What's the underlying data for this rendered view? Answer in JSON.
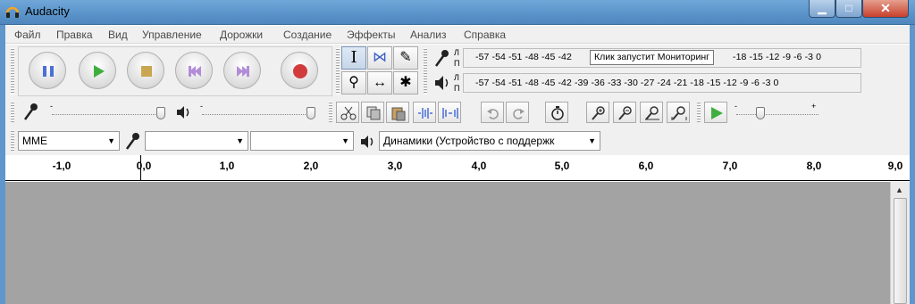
{
  "window": {
    "title": "Audacity",
    "minimize": "▁",
    "maximize": "□",
    "close": "✕"
  },
  "menu": [
    "Файл",
    "Правка",
    "Вид",
    "Управление",
    "Дорожки",
    "Создание",
    "Эффекты",
    "Анализ",
    "Справка"
  ],
  "meters": {
    "record_scale": "-57 -54 -51 -48 -45 -42",
    "record_scale_tail": "-18 -15 -12  -9  -6  -3  0",
    "play_scale": "-57 -54 -51 -48 -45 -42 -39 -36 -33 -30 -27 -24 -21 -18 -15 -12  -9  -6  -3  0",
    "left_channel": "Л",
    "right_channel": "П"
  },
  "tooltip": "Клик запустит Мониторинг",
  "device": {
    "host": "MME",
    "recording_device": "",
    "recording_channels": "",
    "playback_device": "Динамики (Устройство с поддержк"
  },
  "ruler": {
    "labels": [
      "-1,0",
      "0,0",
      "1,0",
      "2,0",
      "3,0",
      "4,0",
      "5,0",
      "6,0",
      "7,0",
      "8,0",
      "9,0"
    ]
  },
  "scroll_up": "▲",
  "combo_arrow": "▼",
  "tools": {
    "select": "I",
    "envelope": "⋈",
    "draw": "✎",
    "zoom": "⚲",
    "timeshift": "↔",
    "multi": "✱"
  },
  "colors": {
    "titlebar": "#5a93c9",
    "pause": "#4a6fd6",
    "play": "#3fae3f",
    "stop": "#c9a64f",
    "skip": "#b38cd8",
    "record": "#d23b3b",
    "track_bg": "#a3a3a3"
  }
}
